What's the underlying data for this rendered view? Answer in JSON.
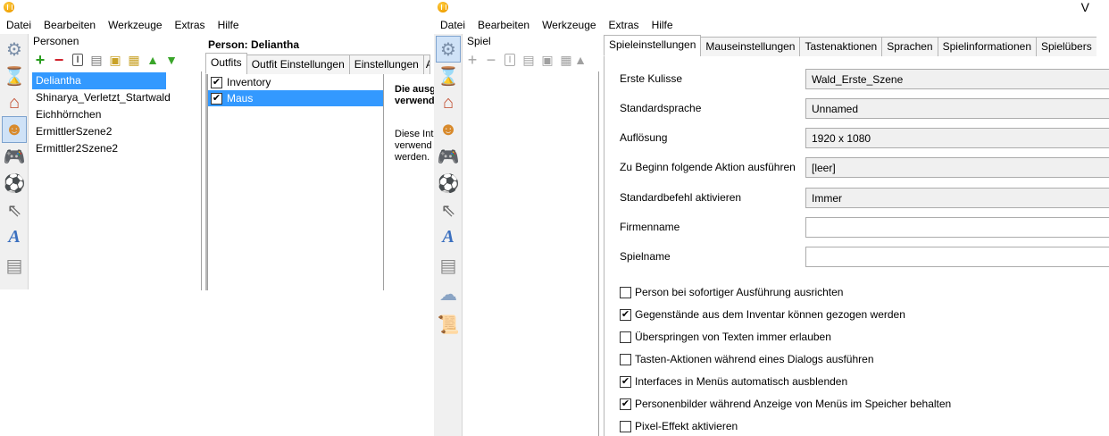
{
  "window_left": {
    "menu": [
      "Datei",
      "Bearbeiten",
      "Werkzeuge",
      "Extras",
      "Hilfe"
    ],
    "panel_title": "Personen",
    "persons": [
      "Deliantha",
      "Shinarya_Verletzt_Startwald",
      "Eichhörnchen",
      "ErmittlerSzene2",
      "Ermittler2Szene2"
    ],
    "selected_person_index": 0,
    "detail_title": "Person: Deliantha",
    "tabs": [
      "Outfits",
      "Outfit Einstellungen",
      "Einstellungen",
      "A"
    ],
    "active_tab": 0,
    "outfits": [
      {
        "label": "Inventory",
        "checked": true,
        "selected": false
      },
      {
        "label": "Maus",
        "checked": true,
        "selected": true
      }
    ],
    "info_bold": [
      "Die ausg",
      "verwend"
    ],
    "info_text": [
      "Diese Int",
      "verwend",
      "werden."
    ]
  },
  "window_right": {
    "title_partial": "V",
    "menu": [
      "Datei",
      "Bearbeiten",
      "Werkzeuge",
      "Extras",
      "Hilfe"
    ],
    "panel_title": "Spiel",
    "tabs": [
      "Spieleinstellungen",
      "Mauseinstellungen",
      "Tastenaktionen",
      "Sprachen",
      "Spielinformationen",
      "Spielübers"
    ],
    "active_tab": 0,
    "fields": [
      {
        "label": "Erste Kulisse",
        "value": "Wald_Erste_Szene",
        "kind": "select"
      },
      {
        "label": "Standardsprache",
        "value": "Unnamed",
        "kind": "select"
      },
      {
        "label": "Auflösung",
        "value": "1920 x 1080",
        "kind": "select"
      },
      {
        "label": "Zu Beginn folgende Aktion ausführen",
        "value": "[leer]",
        "kind": "select"
      },
      {
        "label": "Standardbefehl aktivieren",
        "value": "Immer",
        "kind": "select"
      },
      {
        "label": "Firmenname",
        "value": "",
        "kind": "input"
      },
      {
        "label": "Spielname",
        "value": "",
        "kind": "input"
      }
    ],
    "options": [
      {
        "label": "Person bei sofortiger Ausführung ausrichten",
        "checked": false
      },
      {
        "label": "Gegenstände aus dem Inventar können gezogen werden",
        "checked": true
      },
      {
        "label": "Überspringen von Texten immer erlauben",
        "checked": false
      },
      {
        "label": "Tasten-Aktionen während eines Dialogs ausführen",
        "checked": false
      },
      {
        "label": "Interfaces in Menüs automatisch ausblenden",
        "checked": true
      },
      {
        "label": "Personenbilder während Anzeige von Menüs im Speicher behalten",
        "checked": true
      },
      {
        "label": "Pixel-Effekt aktivieren",
        "checked": false
      }
    ]
  },
  "icons": {
    "left_toolbar": [
      "gear-icon",
      "hourglass-icon",
      "house-icon",
      "person-icon",
      "gamepad-icon",
      "ball-icon",
      "cursor-icon",
      "font-icon",
      "document-icon"
    ],
    "right_toolbar": [
      "gear-icon",
      "hourglass-icon",
      "house-icon",
      "person-icon",
      "gamepad-icon",
      "ball-icon",
      "cursor-icon",
      "font-icon",
      "document-icon",
      "weather-icon",
      "scroll-icon"
    ],
    "list_tools": [
      "add-icon",
      "remove-icon",
      "rename-icon",
      "properties-icon",
      "copy-icon",
      "paste-icon",
      "move-up-icon",
      "move-down-icon"
    ]
  },
  "colors": {
    "selection": "#3399ff",
    "toolbar_bg": "#f0f0f0",
    "active_tool": "#cfe2f7"
  }
}
